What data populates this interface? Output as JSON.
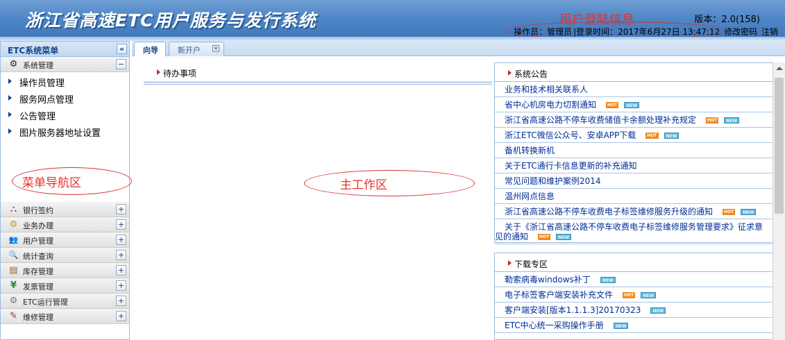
{
  "header": {
    "title": "浙江省高速ETC用户服务与发行系统",
    "annotation": "用户登陆信息",
    "version": "版本：2.0(158)",
    "operator": "操作员：管理员",
    "login_time": "|登录时间：2017年6月27日 13:47:12",
    "change_password": "修改密码",
    "logout": "注销"
  },
  "sidebar": {
    "title": "ETC系统菜单",
    "collapse_icon": "«",
    "system_group": {
      "label": "系统管理",
      "toggle": "−"
    },
    "items": [
      {
        "label": "操作员管理"
      },
      {
        "label": "服务网点管理"
      },
      {
        "label": "公告管理"
      },
      {
        "label": "图片服务器地址设置"
      }
    ],
    "annotation": "菜单导航区",
    "groups": [
      {
        "label": "银行签约",
        "icon": "bank-sign-icon",
        "glyph": "⛬",
        "toggle": "+"
      },
      {
        "label": "业务办理",
        "icon": "gears-icon",
        "glyph": "⚙",
        "toggle": "+"
      },
      {
        "label": "用户管理",
        "icon": "users-icon",
        "glyph": "👥",
        "toggle": "+"
      },
      {
        "label": "统计查询",
        "icon": "magnifier-icon",
        "glyph": "🔍",
        "toggle": "+"
      },
      {
        "label": "库存管理",
        "icon": "inventory-icon",
        "glyph": "▤",
        "toggle": "+"
      },
      {
        "label": "发票管理",
        "icon": "invoice-icon",
        "glyph": "¥",
        "toggle": "+"
      },
      {
        "label": "ETC运行管理",
        "icon": "gear-icon",
        "glyph": "⚙",
        "toggle": "+"
      },
      {
        "label": "维修管理",
        "icon": "repair-icon",
        "glyph": "✎",
        "toggle": "+"
      }
    ]
  },
  "tabs": [
    {
      "label": "向导"
    },
    {
      "label": "新开户",
      "close": "×"
    }
  ],
  "main": {
    "todo_title": "待办事项",
    "annotation": "主工作区",
    "notice": {
      "title": "系统公告",
      "hot": "HOT",
      "new": "NEW",
      "items": [
        {
          "label": "业务和技术相关联系人",
          "hot": false,
          "new": false
        },
        {
          "label": "省中心机房电力切割通知",
          "hot": true,
          "new": true
        },
        {
          "label": "浙江省高速公路不停车收费储值卡余额处理补充规定",
          "hot": true,
          "new": true
        },
        {
          "label": "浙江ETC微信公众号、安卓APP下载",
          "hot": true,
          "new": true
        },
        {
          "label": "备机转换新机",
          "hot": false,
          "new": false
        },
        {
          "label": "关于ETC通行卡信息更新的补充通知",
          "hot": false,
          "new": false
        },
        {
          "label": "常见问题和维护案例2014",
          "hot": false,
          "new": false
        },
        {
          "label": "温州网点信息",
          "hot": false,
          "new": false
        },
        {
          "label": "浙江省高速公路不停车收费电子标签维修服务升级的通知",
          "hot": true,
          "new": true
        },
        {
          "label": "关于《浙江省高速公路不停车收费电子标签维修服务管理要求》征求意见的通知",
          "hot": true,
          "new": true
        }
      ]
    },
    "download": {
      "title": "下载专区",
      "items": [
        {
          "label": "勒索病毒windows补丁",
          "hot": false,
          "new": true
        },
        {
          "label": "电子标签客户端安装补充文件",
          "hot": true,
          "new": true
        },
        {
          "label": "客户端安装[版本1.1.1.3]20170323",
          "hot": false,
          "new": true
        },
        {
          "label": "ETC中心统一采购操作手册",
          "hot": false,
          "new": true
        }
      ]
    }
  }
}
